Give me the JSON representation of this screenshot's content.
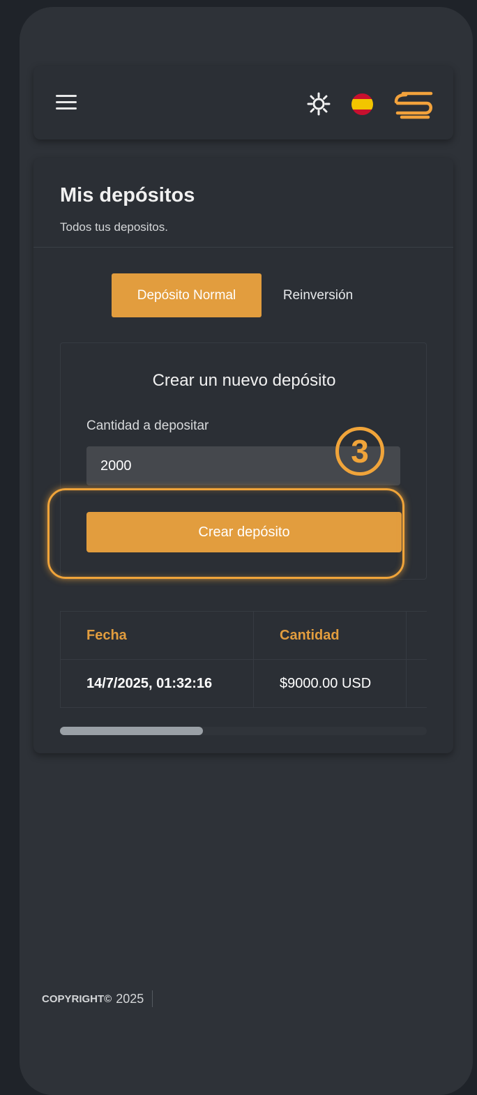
{
  "header": {
    "menu_icon": "hamburger-menu-icon",
    "theme_icon": "sun-icon",
    "language_flag": "spain-flag",
    "logo_icon": "brand-logo",
    "accent_color": "#e29d3e"
  },
  "deposits": {
    "title": "Mis depósitos",
    "subtitle": "Todos tus depositos.",
    "tabs": [
      {
        "label": "Depósito Normal",
        "active": true
      },
      {
        "label": "Reinversión",
        "active": false
      }
    ],
    "form": {
      "title": "Crear un nuevo depósito",
      "amount_label": "Cantidad a depositar",
      "amount_value": "2000",
      "submit_label": "Crear depósito"
    },
    "table": {
      "headers": [
        "Fecha",
        "Cantidad"
      ],
      "rows": [
        {
          "date": "14/7/2025, 01:32:16",
          "amount": "$9000.00 USD"
        }
      ],
      "scroll_fraction": 0.39
    }
  },
  "annotation": {
    "step_number": "3"
  },
  "footer": {
    "copyright_label": "COPYRIGHT©",
    "year": "2025"
  }
}
